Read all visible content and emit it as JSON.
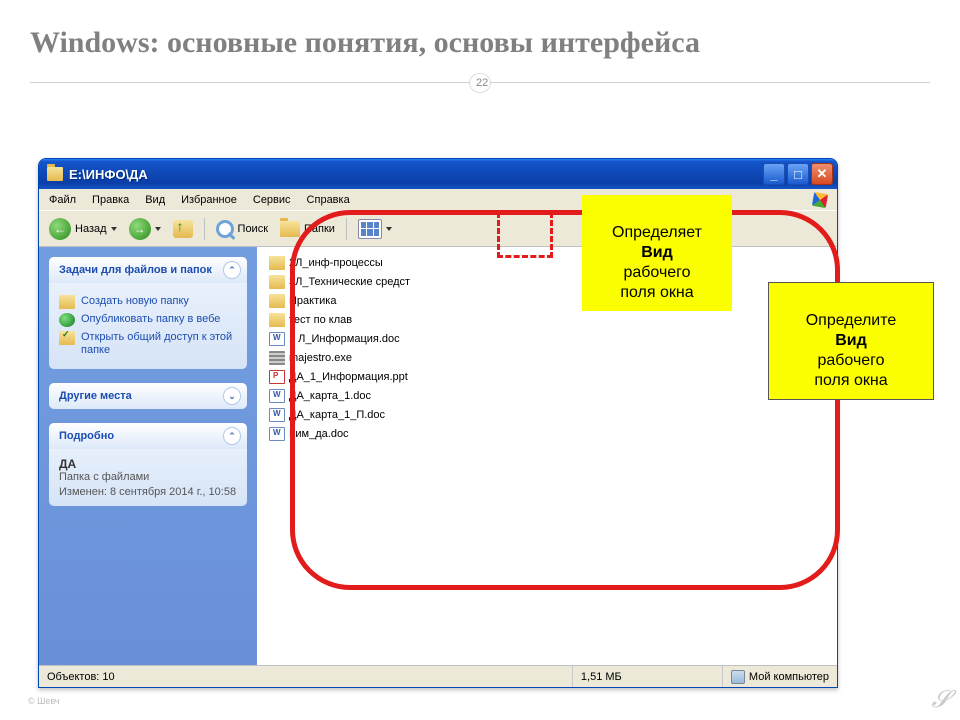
{
  "slide": {
    "title": "Windows: основные понятия, основы интерфейса",
    "number": "22",
    "footer_credit": "© Шевч"
  },
  "window": {
    "title": "E:\\ИНФО\\ДА",
    "menu": [
      "Файл",
      "Правка",
      "Вид",
      "Избранное",
      "Сервис",
      "Справка"
    ],
    "toolbar": {
      "back": "Назад",
      "search": "Поиск",
      "folders": "Папки"
    }
  },
  "sidepanel": {
    "tasks": {
      "title": "Задачи для файлов и папок",
      "items": [
        "Создать новую папку",
        "Опубликовать папку в вебе",
        "Открыть общий доступ к этой папке"
      ]
    },
    "places": {
      "title": "Другие места"
    },
    "details": {
      "title": "Подробно",
      "name": "ДА",
      "type": "Папка с файлами",
      "modified": "Изменен: 8 сентября 2014 г., 10:58"
    }
  },
  "files": [
    {
      "type": "folder",
      "name": "2Л_инф-процессы"
    },
    {
      "type": "folder",
      "name": "3Л_Технические средст"
    },
    {
      "type": "folder",
      "name": "Практика"
    },
    {
      "type": "folder",
      "name": "тест по клав"
    },
    {
      "type": "doc",
      "name": "1 Л_Информация.doc"
    },
    {
      "type": "exe",
      "name": "majestro.exe"
    },
    {
      "type": "ppt",
      "name": "ДА_1_Информация.ppt"
    },
    {
      "type": "doc",
      "name": "ДА_карта_1.doc"
    },
    {
      "type": "doc",
      "name": "ДА_карта_1_П.doc"
    },
    {
      "type": "doc",
      "name": "Ким_да.doc"
    }
  ],
  "statusbar": {
    "objects": "Объектов: 10",
    "size": "1,51 МБ",
    "location": "Мой компьютер"
  },
  "callouts": {
    "c1_line1": "Определяет",
    "c1_bold": "Вид",
    "c1_rest": "рабочего\nполя окна",
    "c2_line1": "Определите",
    "c2_bold": "Вид",
    "c2_rest": "рабочего\nполя окна"
  }
}
